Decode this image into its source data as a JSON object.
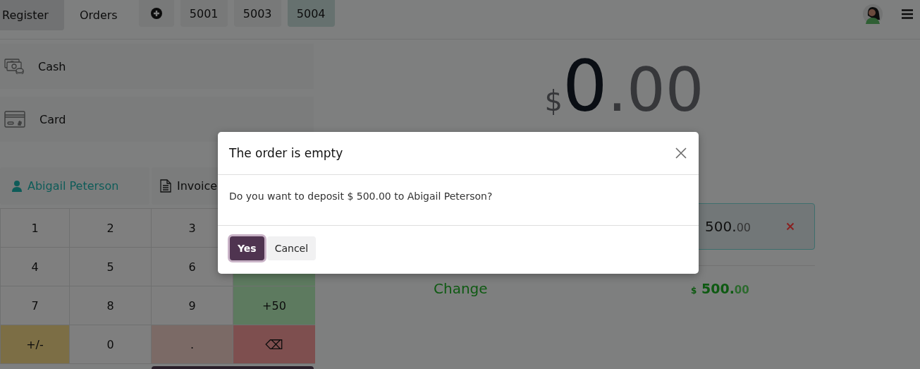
{
  "header": {
    "tabs": [
      {
        "label": "Register",
        "selected": true
      },
      {
        "label": "Orders",
        "selected": false
      }
    ],
    "orders": [
      {
        "label": "5001",
        "selected": false
      },
      {
        "label": "5003",
        "selected": false
      },
      {
        "label": "5004",
        "selected": true
      }
    ]
  },
  "payment_methods": [
    {
      "label": "Cash",
      "kind": "cash"
    },
    {
      "label": "Card",
      "kind": "card"
    }
  ],
  "customer": {
    "name": "Abigail Peterson"
  },
  "invoice_button": {
    "label": "Invoice"
  },
  "keypad": [
    {
      "label": "1",
      "kind": "digit"
    },
    {
      "label": "2",
      "kind": "digit"
    },
    {
      "label": "3",
      "kind": "digit"
    },
    {
      "label": "4",
      "kind": "digit"
    },
    {
      "label": "5",
      "kind": "digit"
    },
    {
      "label": "6",
      "kind": "digit"
    },
    {
      "kind": "quick"
    },
    {
      "label": "7",
      "kind": "digit"
    },
    {
      "label": "8",
      "kind": "digit"
    },
    {
      "label": "9",
      "kind": "digit"
    },
    {
      "label": "+50",
      "kind": "quick"
    },
    {
      "label": "+/-",
      "kind": "sign"
    },
    {
      "label": "0",
      "kind": "digit"
    },
    {
      "label": ".",
      "kind": "dot"
    },
    {
      "label": "⌫",
      "kind": "backspace"
    }
  ],
  "total": {
    "currency": "$",
    "integer": "0",
    "decimals": ".00"
  },
  "payment_line": {
    "amount": "500.",
    "decimals": "00"
  },
  "change": {
    "label": "Change",
    "currency": "$",
    "amount": "500.",
    "decimals": "00"
  },
  "dialog": {
    "title": "The order is empty",
    "message": "Do you want to deposit $ 500.00 to Abigail Peterson?",
    "buttons": [
      {
        "label": "Yes",
        "kind": "primary"
      },
      {
        "label": "Cancel",
        "kind": "secondary"
      }
    ]
  }
}
